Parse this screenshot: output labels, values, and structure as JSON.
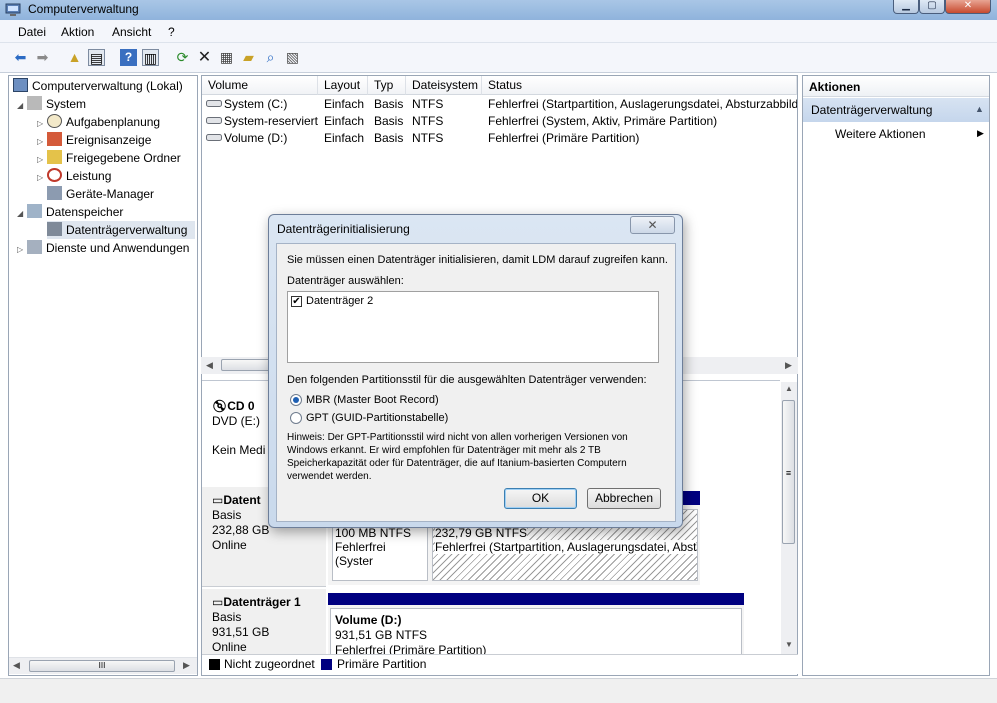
{
  "window": {
    "title": "Computerverwaltung"
  },
  "menu": [
    "Datei",
    "Aktion",
    "Ansicht",
    "?"
  ],
  "tree": {
    "items": [
      {
        "label": "Computerverwaltung (Lokal)",
        "icon": "computer-icon"
      },
      {
        "label": "System",
        "icon": "tools-icon"
      },
      {
        "label": "Aufgabenplanung",
        "icon": "clock-icon"
      },
      {
        "label": "Ereignisanzeige",
        "icon": "event-viewer-icon"
      },
      {
        "label": "Freigegebene Ordner",
        "icon": "shared-folder-icon"
      },
      {
        "label": "Leistung",
        "icon": "performance-icon"
      },
      {
        "label": "Geräte-Manager",
        "icon": "device-manager-icon"
      },
      {
        "label": "Datenspeicher",
        "icon": "storage-icon"
      },
      {
        "label": "Datenträgerverwaltung",
        "icon": "disk-management-icon"
      },
      {
        "label": "Dienste und Anwendungen",
        "icon": "services-icon"
      }
    ],
    "scroll_label": "III"
  },
  "volumes": {
    "headers": [
      "Volume",
      "Layout",
      "Typ",
      "Dateisystem",
      "Status"
    ],
    "rows": [
      [
        "System (C:)",
        "Einfach",
        "Basis",
        "NTFS",
        "Fehlerfrei (Startpartition, Auslagerungsdatei, Absturzabbild"
      ],
      [
        "System-reserviert",
        "Einfach",
        "Basis",
        "NTFS",
        "Fehlerfrei (System, Aktiv, Primäre Partition)"
      ],
      [
        "Volume (D:)",
        "Einfach",
        "Basis",
        "NTFS",
        "Fehlerfrei (Primäre Partition)"
      ]
    ]
  },
  "disks": {
    "cd": {
      "name": "CD 0",
      "type": "DVD (E:)",
      "media": "Kein Medi"
    },
    "disk0": {
      "name": "Datent",
      "type": "Basis",
      "size": "232,88 GB",
      "state": "Online",
      "p1_size": "100 MB NTFS",
      "p1_status": "Fehlerfrei (Syster",
      "p2_size": "232,79 GB NTFS",
      "p2_status": "Fehlerfrei (Startpartition, Auslagerungsdatei, Abst"
    },
    "disk1": {
      "name": "Datenträger 1",
      "type": "Basis",
      "size": "931,51 GB",
      "state": "Online",
      "p_name": "Volume  (D:)",
      "p_size": "931,51 GB NTFS",
      "p_status": "Fehlerfrei (Primäre Partition)"
    }
  },
  "legend": {
    "unallocated": "Nicht zugeordnet",
    "primary": "Primäre Partition"
  },
  "actions": {
    "header": "Aktionen",
    "section": "Datenträgerverwaltung",
    "more": "Weitere Aktionen"
  },
  "dialog": {
    "title": "Datenträgerinitialisierung",
    "intro": "Sie müssen einen Datenträger initialisieren, damit LDM darauf zugreifen kann.",
    "select_label": "Datenträger auswählen:",
    "disk_item": "Datenträger 2",
    "style_label": "Den folgenden Partitionsstil für die ausgewählten Datenträger verwenden:",
    "option_mbr": "MBR (Master Boot Record)",
    "option_gpt": "GPT (GUID-Partitionstabelle)",
    "hint_1": "Hinweis: Der GPT-Partitionsstil wird nicht von allen vorherigen Versionen von",
    "hint_2": "Windows erkannt. Er wird empfohlen für Datenträger mit mehr als 2 TB",
    "hint_3": "Speicherkapazität oder für Datenträger, die auf Itanium-basierten Computern",
    "hint_4": "verwendet werden.",
    "ok": "OK",
    "cancel": "Abbrechen"
  },
  "colors": {
    "primary_partition": "#000080",
    "unallocated": "#000000",
    "title_bar": "#9dbce0"
  }
}
